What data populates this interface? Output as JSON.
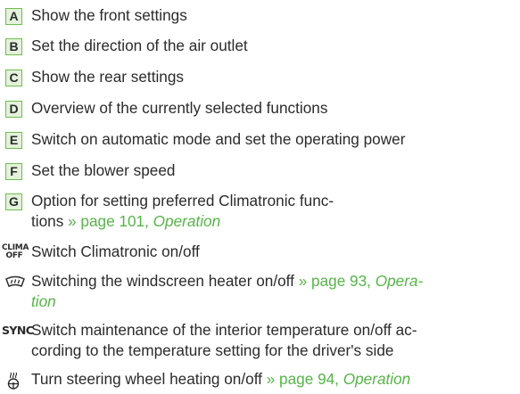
{
  "items": [
    {
      "key": "A",
      "text": "Show the front settings"
    },
    {
      "key": "B",
      "text": "Set the direction of the air outlet"
    },
    {
      "key": "C",
      "text": "Show the rear settings"
    },
    {
      "key": "D",
      "text": "Overview of the currently selected functions"
    },
    {
      "key": "E",
      "text": "Switch on automatic mode and set the operating power"
    },
    {
      "key": "F",
      "text": "Set the blower speed"
    },
    {
      "key": "G",
      "line1": "Option for setting preferred Climatronic func-",
      "line2_text": "tions ",
      "link": "» page 101, ",
      "link_em": "Operation"
    }
  ],
  "clima": {
    "icon_top": "CLIMA",
    "icon_bottom": "OFF",
    "text": "Switch Climatronic on/off"
  },
  "windscreen": {
    "icon": "windscreen-heater-icon",
    "text": "Switching the windscreen heater on/off ",
    "link": "» page 93, ",
    "link_em1": "Opera-",
    "link_em2": "tion"
  },
  "sync": {
    "icon": "SYNC",
    "line1": "Switch maintenance of the interior temperature on/off ac-",
    "line2": "cording to the temperature setting for the driver's side"
  },
  "steering": {
    "icon": "steering-wheel-heating-icon",
    "text": "Turn steering wheel heating on/off ",
    "link": "» page 94, ",
    "link_em": "Operation"
  },
  "colors": {
    "accent": "#56b548",
    "key_fill": "#e4f2dc",
    "key_border": "#6cbf4a",
    "text": "#2b2b2b"
  }
}
